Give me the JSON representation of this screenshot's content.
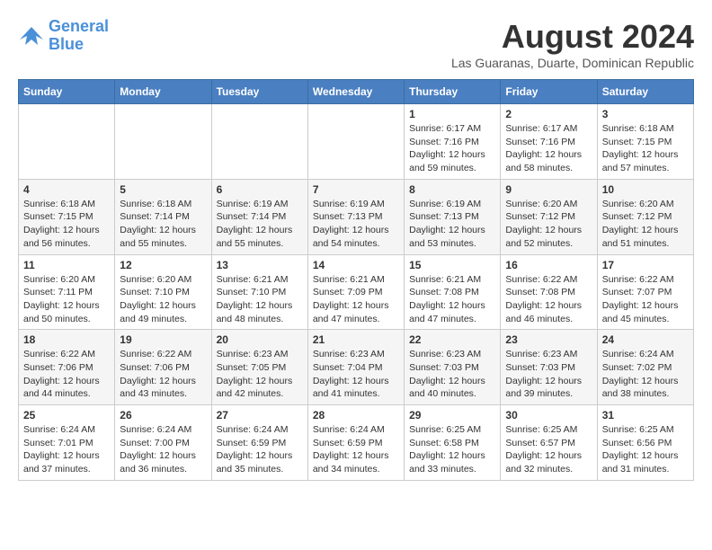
{
  "header": {
    "logo_line1": "General",
    "logo_line2": "Blue",
    "month_year": "August 2024",
    "location": "Las Guaranas, Duarte, Dominican Republic"
  },
  "weekdays": [
    "Sunday",
    "Monday",
    "Tuesday",
    "Wednesday",
    "Thursday",
    "Friday",
    "Saturday"
  ],
  "weeks": [
    [
      {
        "day": "",
        "info": ""
      },
      {
        "day": "",
        "info": ""
      },
      {
        "day": "",
        "info": ""
      },
      {
        "day": "",
        "info": ""
      },
      {
        "day": "1",
        "info": "Sunrise: 6:17 AM\nSunset: 7:16 PM\nDaylight: 12 hours\nand 59 minutes."
      },
      {
        "day": "2",
        "info": "Sunrise: 6:17 AM\nSunset: 7:16 PM\nDaylight: 12 hours\nand 58 minutes."
      },
      {
        "day": "3",
        "info": "Sunrise: 6:18 AM\nSunset: 7:15 PM\nDaylight: 12 hours\nand 57 minutes."
      }
    ],
    [
      {
        "day": "4",
        "info": "Sunrise: 6:18 AM\nSunset: 7:15 PM\nDaylight: 12 hours\nand 56 minutes."
      },
      {
        "day": "5",
        "info": "Sunrise: 6:18 AM\nSunset: 7:14 PM\nDaylight: 12 hours\nand 55 minutes."
      },
      {
        "day": "6",
        "info": "Sunrise: 6:19 AM\nSunset: 7:14 PM\nDaylight: 12 hours\nand 55 minutes."
      },
      {
        "day": "7",
        "info": "Sunrise: 6:19 AM\nSunset: 7:13 PM\nDaylight: 12 hours\nand 54 minutes."
      },
      {
        "day": "8",
        "info": "Sunrise: 6:19 AM\nSunset: 7:13 PM\nDaylight: 12 hours\nand 53 minutes."
      },
      {
        "day": "9",
        "info": "Sunrise: 6:20 AM\nSunset: 7:12 PM\nDaylight: 12 hours\nand 52 minutes."
      },
      {
        "day": "10",
        "info": "Sunrise: 6:20 AM\nSunset: 7:12 PM\nDaylight: 12 hours\nand 51 minutes."
      }
    ],
    [
      {
        "day": "11",
        "info": "Sunrise: 6:20 AM\nSunset: 7:11 PM\nDaylight: 12 hours\nand 50 minutes."
      },
      {
        "day": "12",
        "info": "Sunrise: 6:20 AM\nSunset: 7:10 PM\nDaylight: 12 hours\nand 49 minutes."
      },
      {
        "day": "13",
        "info": "Sunrise: 6:21 AM\nSunset: 7:10 PM\nDaylight: 12 hours\nand 48 minutes."
      },
      {
        "day": "14",
        "info": "Sunrise: 6:21 AM\nSunset: 7:09 PM\nDaylight: 12 hours\nand 47 minutes."
      },
      {
        "day": "15",
        "info": "Sunrise: 6:21 AM\nSunset: 7:08 PM\nDaylight: 12 hours\nand 47 minutes."
      },
      {
        "day": "16",
        "info": "Sunrise: 6:22 AM\nSunset: 7:08 PM\nDaylight: 12 hours\nand 46 minutes."
      },
      {
        "day": "17",
        "info": "Sunrise: 6:22 AM\nSunset: 7:07 PM\nDaylight: 12 hours\nand 45 minutes."
      }
    ],
    [
      {
        "day": "18",
        "info": "Sunrise: 6:22 AM\nSunset: 7:06 PM\nDaylight: 12 hours\nand 44 minutes."
      },
      {
        "day": "19",
        "info": "Sunrise: 6:22 AM\nSunset: 7:06 PM\nDaylight: 12 hours\nand 43 minutes."
      },
      {
        "day": "20",
        "info": "Sunrise: 6:23 AM\nSunset: 7:05 PM\nDaylight: 12 hours\nand 42 minutes."
      },
      {
        "day": "21",
        "info": "Sunrise: 6:23 AM\nSunset: 7:04 PM\nDaylight: 12 hours\nand 41 minutes."
      },
      {
        "day": "22",
        "info": "Sunrise: 6:23 AM\nSunset: 7:03 PM\nDaylight: 12 hours\nand 40 minutes."
      },
      {
        "day": "23",
        "info": "Sunrise: 6:23 AM\nSunset: 7:03 PM\nDaylight: 12 hours\nand 39 minutes."
      },
      {
        "day": "24",
        "info": "Sunrise: 6:24 AM\nSunset: 7:02 PM\nDaylight: 12 hours\nand 38 minutes."
      }
    ],
    [
      {
        "day": "25",
        "info": "Sunrise: 6:24 AM\nSunset: 7:01 PM\nDaylight: 12 hours\nand 37 minutes."
      },
      {
        "day": "26",
        "info": "Sunrise: 6:24 AM\nSunset: 7:00 PM\nDaylight: 12 hours\nand 36 minutes."
      },
      {
        "day": "27",
        "info": "Sunrise: 6:24 AM\nSunset: 6:59 PM\nDaylight: 12 hours\nand 35 minutes."
      },
      {
        "day": "28",
        "info": "Sunrise: 6:24 AM\nSunset: 6:59 PM\nDaylight: 12 hours\nand 34 minutes."
      },
      {
        "day": "29",
        "info": "Sunrise: 6:25 AM\nSunset: 6:58 PM\nDaylight: 12 hours\nand 33 minutes."
      },
      {
        "day": "30",
        "info": "Sunrise: 6:25 AM\nSunset: 6:57 PM\nDaylight: 12 hours\nand 32 minutes."
      },
      {
        "day": "31",
        "info": "Sunrise: 6:25 AM\nSunset: 6:56 PM\nDaylight: 12 hours\nand 31 minutes."
      }
    ]
  ]
}
